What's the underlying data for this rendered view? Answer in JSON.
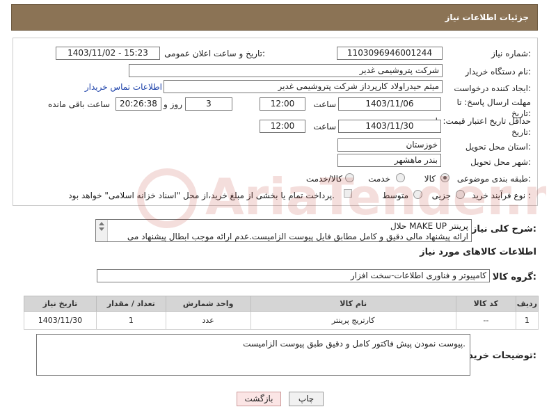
{
  "header": {
    "title": "جزئیات اطلاعات نیاز"
  },
  "form": {
    "need_number": {
      "label": "شماره نیاز:",
      "value": "1103096946001244"
    },
    "announce_datetime": {
      "label": "تاریخ و ساعت اعلان عمومی:",
      "value": "1403/11/02 - 15:23"
    },
    "buyer_org": {
      "label": "نام دستگاه خریدار:",
      "value": "شرکت پتروشیمی غدیر"
    },
    "requester": {
      "label": "ایجاد کننده درخواست:",
      "value": "میثم حیدراولاد کارپرداز شرکت پتروشیمی غدیر",
      "link": "اطلاعات تماس خریدار"
    },
    "reply_deadline": {
      "label": "مهلت ارسال پاسخ: تا تاریخ:",
      "date": "1403/11/06",
      "time_label": "ساعت",
      "time": "12:00",
      "days": "3",
      "days_label": "روز و",
      "remaining": "20:26:38",
      "remaining_label": "ساعت باقی مانده"
    },
    "price_validity": {
      "label": "حداقل تاریخ اعتبار قیمت: تا تاریخ:",
      "date": "1403/11/30",
      "time_label": "ساعت",
      "time": "12:00"
    },
    "province": {
      "label": "استان محل تحویل:",
      "value": "خوزستان"
    },
    "city": {
      "label": "شهر محل تحویل:",
      "value": "بندر ماهشهر"
    },
    "category": {
      "label": "طبقه بندی موضوعی:",
      "options": [
        "کالا",
        "خدمت",
        "کالا/خدمت"
      ],
      "selected": "کالا"
    },
    "process": {
      "label": "نوع فرآیند خرید :",
      "options": [
        "جزیی",
        "متوسط"
      ],
      "note": "پرداخت تمام یا بخشی از مبلغ خرید،از محل \"اسناد خزانه اسلامی\" خواهد بود."
    }
  },
  "description": {
    "label": "شرح کلی نیاز:",
    "line1": "حلال MAKE UP پرینتر",
    "line2": "ارائه پیشنهاد مالی دقیق و کامل مطابق فایل پیوست الزامیست.عدم ارائه موجب ابطال پیشنهاد می"
  },
  "goods_section": {
    "title": "اطلاعات کالاهای مورد نیاز",
    "group_label": "گروه کالا:",
    "group_value": "کامپیوتر و فناوری اطلاعات-سخت افزار"
  },
  "table": {
    "headers": [
      "ردیف",
      "کد کالا",
      "نام کالا",
      "واحد شمارش",
      "تعداد / مقدار",
      "تاریخ نیاز"
    ],
    "rows": [
      [
        "1",
        "--",
        "کارتریج پرینتر",
        "عدد",
        "1",
        "1403/11/30"
      ]
    ]
  },
  "buyer_notes": {
    "label": "توضیحات خریدار:",
    "value": "پیوست نمودن پیش فاکتور کامل و دقیق طبق پیوست الزامیست."
  },
  "buttons": {
    "print": "چاپ",
    "back": "بازگشت"
  },
  "watermark": {
    "text": "AriaTender.net"
  }
}
